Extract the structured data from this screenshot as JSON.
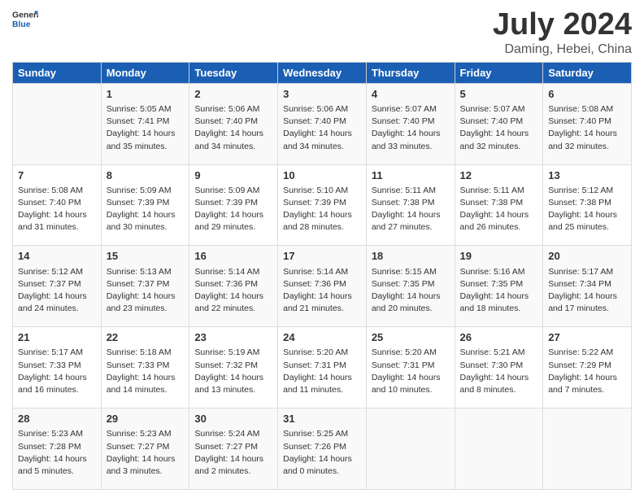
{
  "logo": {
    "line1": "General",
    "line2": "Blue"
  },
  "title": "July 2024",
  "subtitle": "Daming, Hebei, China",
  "days_header": [
    "Sunday",
    "Monday",
    "Tuesday",
    "Wednesday",
    "Thursday",
    "Friday",
    "Saturday"
  ],
  "weeks": [
    [
      {
        "day": "",
        "lines": []
      },
      {
        "day": "1",
        "lines": [
          "Sunrise: 5:05 AM",
          "Sunset: 7:41 PM",
          "Daylight: 14 hours",
          "and 35 minutes."
        ]
      },
      {
        "day": "2",
        "lines": [
          "Sunrise: 5:06 AM",
          "Sunset: 7:40 PM",
          "Daylight: 14 hours",
          "and 34 minutes."
        ]
      },
      {
        "day": "3",
        "lines": [
          "Sunrise: 5:06 AM",
          "Sunset: 7:40 PM",
          "Daylight: 14 hours",
          "and 34 minutes."
        ]
      },
      {
        "day": "4",
        "lines": [
          "Sunrise: 5:07 AM",
          "Sunset: 7:40 PM",
          "Daylight: 14 hours",
          "and 33 minutes."
        ]
      },
      {
        "day": "5",
        "lines": [
          "Sunrise: 5:07 AM",
          "Sunset: 7:40 PM",
          "Daylight: 14 hours",
          "and 32 minutes."
        ]
      },
      {
        "day": "6",
        "lines": [
          "Sunrise: 5:08 AM",
          "Sunset: 7:40 PM",
          "Daylight: 14 hours",
          "and 32 minutes."
        ]
      }
    ],
    [
      {
        "day": "7",
        "lines": [
          "Sunrise: 5:08 AM",
          "Sunset: 7:40 PM",
          "Daylight: 14 hours",
          "and 31 minutes."
        ]
      },
      {
        "day": "8",
        "lines": [
          "Sunrise: 5:09 AM",
          "Sunset: 7:39 PM",
          "Daylight: 14 hours",
          "and 30 minutes."
        ]
      },
      {
        "day": "9",
        "lines": [
          "Sunrise: 5:09 AM",
          "Sunset: 7:39 PM",
          "Daylight: 14 hours",
          "and 29 minutes."
        ]
      },
      {
        "day": "10",
        "lines": [
          "Sunrise: 5:10 AM",
          "Sunset: 7:39 PM",
          "Daylight: 14 hours",
          "and 28 minutes."
        ]
      },
      {
        "day": "11",
        "lines": [
          "Sunrise: 5:11 AM",
          "Sunset: 7:38 PM",
          "Daylight: 14 hours",
          "and 27 minutes."
        ]
      },
      {
        "day": "12",
        "lines": [
          "Sunrise: 5:11 AM",
          "Sunset: 7:38 PM",
          "Daylight: 14 hours",
          "and 26 minutes."
        ]
      },
      {
        "day": "13",
        "lines": [
          "Sunrise: 5:12 AM",
          "Sunset: 7:38 PM",
          "Daylight: 14 hours",
          "and 25 minutes."
        ]
      }
    ],
    [
      {
        "day": "14",
        "lines": [
          "Sunrise: 5:12 AM",
          "Sunset: 7:37 PM",
          "Daylight: 14 hours",
          "and 24 minutes."
        ]
      },
      {
        "day": "15",
        "lines": [
          "Sunrise: 5:13 AM",
          "Sunset: 7:37 PM",
          "Daylight: 14 hours",
          "and 23 minutes."
        ]
      },
      {
        "day": "16",
        "lines": [
          "Sunrise: 5:14 AM",
          "Sunset: 7:36 PM",
          "Daylight: 14 hours",
          "and 22 minutes."
        ]
      },
      {
        "day": "17",
        "lines": [
          "Sunrise: 5:14 AM",
          "Sunset: 7:36 PM",
          "Daylight: 14 hours",
          "and 21 minutes."
        ]
      },
      {
        "day": "18",
        "lines": [
          "Sunrise: 5:15 AM",
          "Sunset: 7:35 PM",
          "Daylight: 14 hours",
          "and 20 minutes."
        ]
      },
      {
        "day": "19",
        "lines": [
          "Sunrise: 5:16 AM",
          "Sunset: 7:35 PM",
          "Daylight: 14 hours",
          "and 18 minutes."
        ]
      },
      {
        "day": "20",
        "lines": [
          "Sunrise: 5:17 AM",
          "Sunset: 7:34 PM",
          "Daylight: 14 hours",
          "and 17 minutes."
        ]
      }
    ],
    [
      {
        "day": "21",
        "lines": [
          "Sunrise: 5:17 AM",
          "Sunset: 7:33 PM",
          "Daylight: 14 hours",
          "and 16 minutes."
        ]
      },
      {
        "day": "22",
        "lines": [
          "Sunrise: 5:18 AM",
          "Sunset: 7:33 PM",
          "Daylight: 14 hours",
          "and 14 minutes."
        ]
      },
      {
        "day": "23",
        "lines": [
          "Sunrise: 5:19 AM",
          "Sunset: 7:32 PM",
          "Daylight: 14 hours",
          "and 13 minutes."
        ]
      },
      {
        "day": "24",
        "lines": [
          "Sunrise: 5:20 AM",
          "Sunset: 7:31 PM",
          "Daylight: 14 hours",
          "and 11 minutes."
        ]
      },
      {
        "day": "25",
        "lines": [
          "Sunrise: 5:20 AM",
          "Sunset: 7:31 PM",
          "Daylight: 14 hours",
          "and 10 minutes."
        ]
      },
      {
        "day": "26",
        "lines": [
          "Sunrise: 5:21 AM",
          "Sunset: 7:30 PM",
          "Daylight: 14 hours",
          "and 8 minutes."
        ]
      },
      {
        "day": "27",
        "lines": [
          "Sunrise: 5:22 AM",
          "Sunset: 7:29 PM",
          "Daylight: 14 hours",
          "and 7 minutes."
        ]
      }
    ],
    [
      {
        "day": "28",
        "lines": [
          "Sunrise: 5:23 AM",
          "Sunset: 7:28 PM",
          "Daylight: 14 hours",
          "and 5 minutes."
        ]
      },
      {
        "day": "29",
        "lines": [
          "Sunrise: 5:23 AM",
          "Sunset: 7:27 PM",
          "Daylight: 14 hours",
          "and 3 minutes."
        ]
      },
      {
        "day": "30",
        "lines": [
          "Sunrise: 5:24 AM",
          "Sunset: 7:27 PM",
          "Daylight: 14 hours",
          "and 2 minutes."
        ]
      },
      {
        "day": "31",
        "lines": [
          "Sunrise: 5:25 AM",
          "Sunset: 7:26 PM",
          "Daylight: 14 hours",
          "and 0 minutes."
        ]
      },
      {
        "day": "",
        "lines": []
      },
      {
        "day": "",
        "lines": []
      },
      {
        "day": "",
        "lines": []
      }
    ]
  ]
}
